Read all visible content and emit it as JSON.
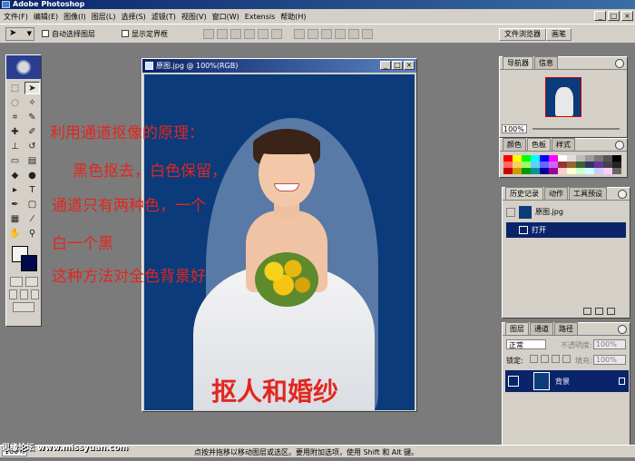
{
  "app": {
    "title": "Adobe Photoshop"
  },
  "menu": [
    "文件(F)",
    "编辑(E)",
    "图像(I)",
    "图层(L)",
    "选择(S)",
    "滤镜(T)",
    "视图(V)",
    "窗口(W)",
    "Extensis",
    "帮助(H)"
  ],
  "window_buttons": {
    "minimize": "_",
    "restore": "□",
    "close": "×"
  },
  "options": {
    "auto_select_label": "自动选择图层",
    "show_bounds_label": "显示定界框",
    "file_browser_tab": "文件浏览器",
    "brushes_tab": "画笔"
  },
  "document": {
    "title": "原图.jpg @ 100%(RGB)",
    "overlay_lines": [
      "利用通道抠像的原理：",
      "黑色抠去，白色保留，",
      "通道只有两种色，一个",
      "白一个黑",
      "这种方法对全色背景好"
    ],
    "caption": "抠人和婚纱"
  },
  "navigator": {
    "tabs": [
      "导航器",
      "信息"
    ],
    "zoom": "100%"
  },
  "color_panel": {
    "tabs": [
      "颜色",
      "色板",
      "样式"
    ]
  },
  "history": {
    "tabs": [
      "历史记录",
      "动作",
      "工具预设"
    ],
    "items": [
      "原图.jpg",
      "打开"
    ]
  },
  "layers": {
    "tabs": [
      "图层",
      "通道",
      "路径"
    ],
    "blend_mode": "正常",
    "opacity_label": "不透明度:",
    "opacity_value": "100%",
    "lock_label": "锁定:",
    "fill_label": "填充:",
    "fill_value": "100%",
    "layer_name": "背景"
  },
  "status": {
    "zoom": "100%",
    "hint": "点按并拖移以移动图层或选区。要用附加选项，使用 Shift 和 Alt 键。"
  },
  "watermark": "思缘论坛   www.missyuan.com",
  "colors": {
    "canvas_bg": "#0b3b7a",
    "overlay_text": "#e3261f",
    "title_bar": "#0a246a",
    "chrome": "#d4d0c8",
    "workspace": "#7b7b7b"
  }
}
